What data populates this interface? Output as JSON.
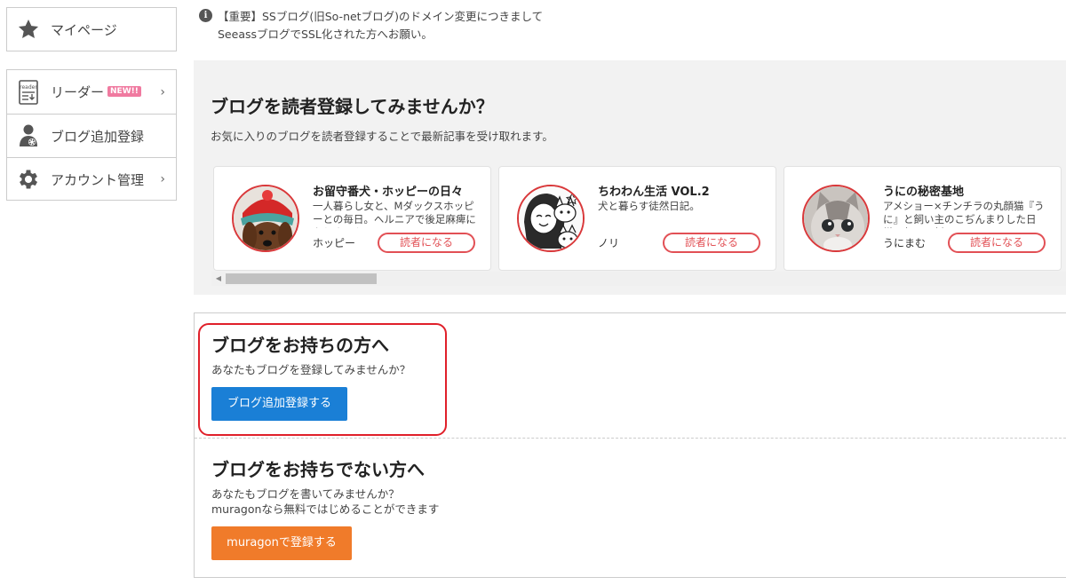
{
  "sidebar": {
    "mypage": {
      "label": "マイページ",
      "icon": "star-icon"
    },
    "items": [
      {
        "label": "リーダー",
        "badge": "NEW!!",
        "icon": "reader-icon",
        "has_chevron": true
      },
      {
        "label": "ブログ追加登録",
        "icon": "user-gear-icon",
        "has_chevron": false
      },
      {
        "label": "アカウント管理",
        "icon": "gear-icon",
        "has_chevron": true
      }
    ],
    "chevron": "›"
  },
  "notice": {
    "icon": "info-icon",
    "line1": "【重要】SSブログ(旧So-netブログ)のドメイン変更につきまして",
    "line2": "SeeassブログでSSL化された方へお願い。"
  },
  "reader_section": {
    "title": "ブログを読者登録してみませんか？",
    "subtitle": "お気に入りのブログを読者登録することで最新記事を受け取れます。",
    "cards": [
      {
        "title": "お留守番犬・ホッピーの日々",
        "description": "一人暮らし女と、Mダックスホッピーとの毎日。ヘルニアで後足麻痺になりました",
        "author": "ホッピー",
        "button": "読者になる"
      },
      {
        "title": "ちわわん生活 VOL.2",
        "description": "犬と暮らす徒然日記。",
        "author": "ノリ",
        "button": "読者になる"
      },
      {
        "title": "うにの秘密基地",
        "description": "アメショー×チンチラの丸顔猫『うに』と飼い主のこぢんまりした日常。毎日更新",
        "author": "うにまむ",
        "button": "読者になる"
      }
    ],
    "scroll_arrow": "◀"
  },
  "owner_section": {
    "title": "ブログをお持ちの方へ",
    "text": "あなたもブログを登録してみませんか？",
    "button": "ブログ追加登録する"
  },
  "nonowner_section": {
    "title": "ブログをお持ちでない方へ",
    "text1": "あなたもブログを書いてみませんか？",
    "text2": "muragonなら無料ではじめることができます",
    "button": "muragonで登録する"
  },
  "colors": {
    "accent_red": "#e25055",
    "highlight_red": "#e0202a",
    "button_blue": "#1a7fd6",
    "button_orange": "#f07b2a",
    "badge_pink": "#f07aa0"
  }
}
